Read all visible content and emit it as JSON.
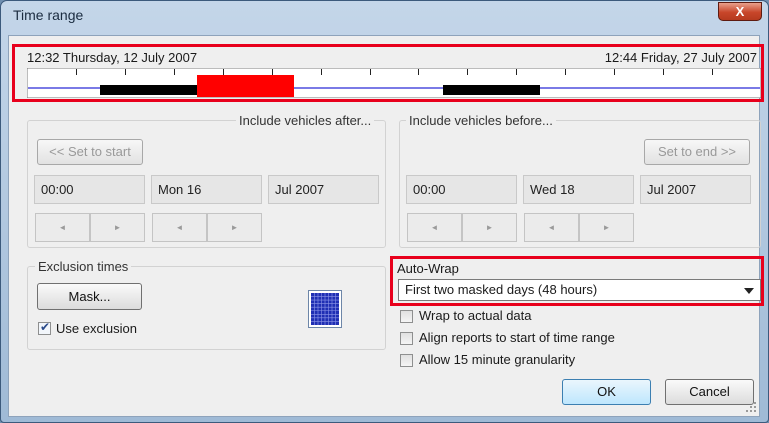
{
  "window": {
    "title": "Time range",
    "close_glyph": "X"
  },
  "timeline": {
    "start_label": "12:32 Thursday, 12 July 2007",
    "end_label": "12:44 Friday, 27 July 2007",
    "track_color": "#2b2bd6",
    "selection_color": "#ff0000",
    "masked_color": "#000000"
  },
  "after": {
    "title": "Include vehicles after...",
    "set_button": "<< Set to start",
    "time": "00:00",
    "day": "Mon 16",
    "month": "Jul 2007"
  },
  "before": {
    "title": "Include vehicles before...",
    "set_button": "Set to end >>",
    "time": "00:00",
    "day": "Wed 18",
    "month": "Jul 2007"
  },
  "spinner": {
    "left_glyph": "◄",
    "right_glyph": "►"
  },
  "exclusion": {
    "title": "Exclusion times",
    "mask_button": "Mask...",
    "use_exclusion_label": "Use exclusion",
    "use_exclusion_checked": true
  },
  "autowrap": {
    "label": "Auto-Wrap",
    "selected": "First two masked days (48 hours)"
  },
  "options": [
    {
      "label": "Wrap to actual data",
      "checked": false
    },
    {
      "label": "Align reports to start of time range",
      "checked": false
    },
    {
      "label": "Allow 15 minute granularity",
      "checked": false
    }
  ],
  "buttons": {
    "ok": "OK",
    "cancel": "Cancel"
  },
  "colors": {
    "highlight": "#e8001c",
    "ok_border": "#3c7fb1"
  }
}
